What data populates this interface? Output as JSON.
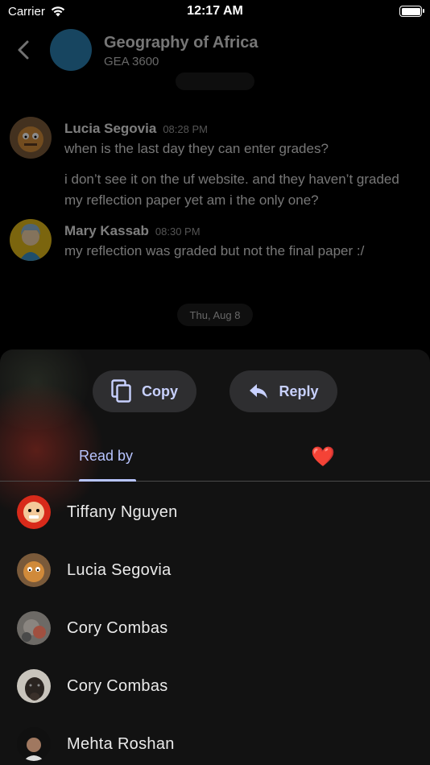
{
  "status_bar": {
    "carrier": "Carrier",
    "time": "12:17 AM"
  },
  "header": {
    "title": "Geography of Africa",
    "subtitle": "GEA 3600"
  },
  "messages": [
    {
      "author": "Lucia Segovia",
      "time": "08:28 PM",
      "lines": [
        "when is the last day they can enter grades?",
        "i don’t see it on the uf website. and they haven’t graded my reflection paper yet am i the only one?"
      ]
    },
    {
      "author": "Mary Kassab",
      "time": "08:30 PM",
      "lines": [
        "my reflection was graded but not the final paper :/"
      ]
    }
  ],
  "date_separator": "Thu, Aug 8",
  "actions": {
    "copy_label": "Copy",
    "reply_label": "Reply"
  },
  "tabs": {
    "read_by": "Read by",
    "reaction": "❤️"
  },
  "readers": [
    {
      "name": "Tiffany Nguyen"
    },
    {
      "name": "Lucia Segovia"
    },
    {
      "name": "Cory Combas"
    },
    {
      "name": "Cory Combas"
    },
    {
      "name": "Mehta Roshan"
    }
  ],
  "colors": {
    "accent": "#b7c4ff",
    "sheet": "#121212",
    "pill": "#2e2e30",
    "heart": "#e0303a"
  },
  "icons": {
    "back": "chevron-left-icon",
    "wifi": "wifi-icon",
    "battery": "battery-icon",
    "copy": "copy-icon",
    "reply": "reply-arrow-icon"
  }
}
